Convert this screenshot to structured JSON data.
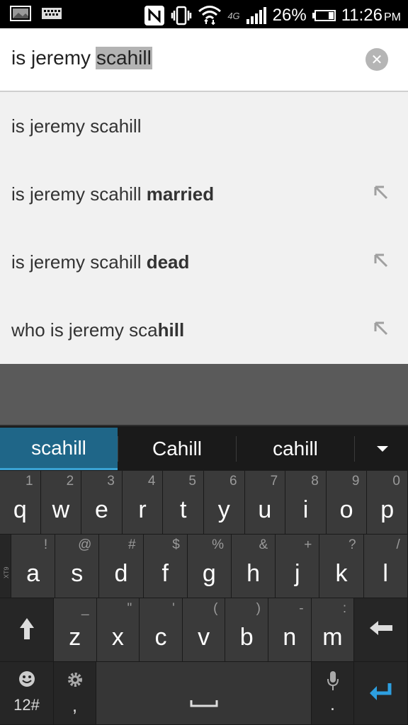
{
  "status_bar": {
    "left_icons": [
      "image-icon",
      "keyboard-icon"
    ],
    "right_icons": [
      "nfc-icon",
      "vibrate-icon",
      "wifi-icon",
      "signal-icon"
    ],
    "network": "4G",
    "battery_percent": "26%",
    "battery_level": 0.26,
    "time": "11:26",
    "ampm": "PM"
  },
  "search": {
    "query_prefix": "is jeremy",
    "query_selected": "scahill",
    "clear_icon": "close-icon"
  },
  "suggestions": [
    {
      "plain": "is jeremy scahill",
      "bold": "",
      "arrow": false
    },
    {
      "plain": "is jeremy scahill ",
      "bold": "married",
      "arrow": true
    },
    {
      "plain": "is jeremy scahill ",
      "bold": "dead",
      "arrow": true
    },
    {
      "plain": "who is jeremy sca",
      "bold": "hill",
      "arrow": true
    }
  ],
  "keyboard": {
    "predictions": [
      "scahill",
      "Cahill",
      "cahill"
    ],
    "selected_prediction": "scahill",
    "side_label": "XT9",
    "row1": [
      {
        "key": "q",
        "hint": "1"
      },
      {
        "key": "w",
        "hint": "2"
      },
      {
        "key": "e",
        "hint": "3"
      },
      {
        "key": "r",
        "hint": "4"
      },
      {
        "key": "t",
        "hint": "5"
      },
      {
        "key": "y",
        "hint": "6"
      },
      {
        "key": "u",
        "hint": "7"
      },
      {
        "key": "i",
        "hint": "8"
      },
      {
        "key": "o",
        "hint": "9"
      },
      {
        "key": "p",
        "hint": "0"
      }
    ],
    "row2": [
      {
        "key": "a",
        "hint": "!"
      },
      {
        "key": "s",
        "hint": "@"
      },
      {
        "key": "d",
        "hint": "#"
      },
      {
        "key": "f",
        "hint": "$"
      },
      {
        "key": "g",
        "hint": "%"
      },
      {
        "key": "h",
        "hint": "&"
      },
      {
        "key": "j",
        "hint": "+"
      },
      {
        "key": "k",
        "hint": "?"
      },
      {
        "key": "l",
        "hint": "/"
      }
    ],
    "row3": [
      {
        "key": "z",
        "hint": "_"
      },
      {
        "key": "x",
        "hint": "\""
      },
      {
        "key": "c",
        "hint": "'"
      },
      {
        "key": "v",
        "hint": "("
      },
      {
        "key": "b",
        "hint": ")"
      },
      {
        "key": "n",
        "hint": "-"
      },
      {
        "key": "m",
        "hint": ":"
      }
    ],
    "symbols_label": "12#",
    "comma_label": ",",
    "period_label": ".",
    "icons": {
      "shift": "shift-icon",
      "backspace": "backspace-icon",
      "emoji": "smiley-icon",
      "settings": "gear-icon",
      "space": "space-icon",
      "mic": "microphone-icon",
      "enter": "enter-icon"
    },
    "accent_color": "#1f6688",
    "enter_color": "#2d9fe0"
  }
}
